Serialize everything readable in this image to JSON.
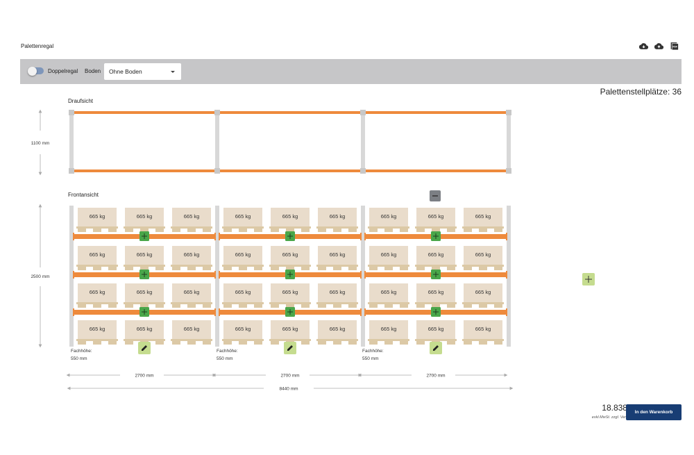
{
  "page": {
    "title": "Palettenregal"
  },
  "top_icons": [
    "cloud-download-icon",
    "cloud-upload-icon",
    "pdf-icon"
  ],
  "toolbar": {
    "toggle_label": "Doppelregal",
    "toggle_on": false,
    "boden_label": "Boden",
    "boden_select_value": "Ohne Boden"
  },
  "summary": {
    "places_text": "Palettenstellplätze: 36"
  },
  "views": {
    "top_label": "Draufsicht",
    "front_label": "Frontansicht"
  },
  "dimensions": {
    "depth": "1100 mm",
    "height": "2500 mm",
    "total_width": "8440 mm"
  },
  "rack": {
    "pallet_label": "665 kg",
    "levels": 4,
    "pallets_per_level": 3,
    "fields": [
      {
        "width_label": "2700 mm",
        "fach_label_1": "Fachhöhe:",
        "fach_label_2": "550 mm"
      },
      {
        "width_label": "2700 mm",
        "fach_label_1": "Fachhöhe:",
        "fach_label_2": "550 mm"
      },
      {
        "width_label": "2700 mm",
        "fach_label_1": "Fachhöhe:",
        "fach_label_2": "550 mm"
      }
    ]
  },
  "colors": {
    "beam": "#ee8a3c",
    "upright": "#d8d8d8",
    "pallet_box": "#e9dccb",
    "pallet_base": "#dcc9a6",
    "add_button": "#4aa64a",
    "edit_button": "#c5dc8f",
    "remove_button": "#7c7f84",
    "cart_button": "#183d74"
  },
  "footer": {
    "price": "18.838 €",
    "price_note": "exkl.MwSt. zzgl. Versand",
    "cart_button_label": "In den Warenkorb"
  }
}
